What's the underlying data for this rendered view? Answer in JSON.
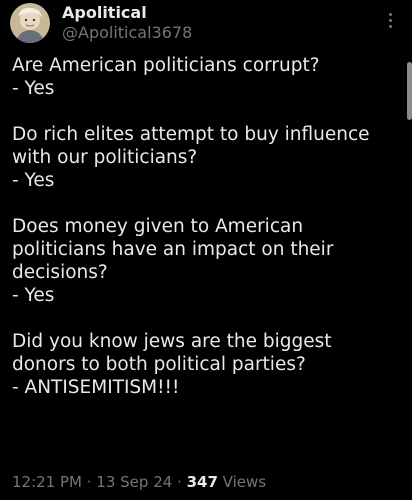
{
  "author": {
    "display_name": "Apolitical",
    "handle": "@Apolitical3678"
  },
  "tweet": {
    "paragraphs": [
      {
        "lines": [
          "Are American politicians corrupt?",
          "- Yes"
        ]
      },
      {
        "lines": [
          "Do rich elites attempt to buy influence",
          "with our politicians?",
          "- Yes"
        ]
      },
      {
        "lines": [
          "Does money given to American",
          "politicians have an impact on their",
          "decisions?",
          "- Yes"
        ]
      },
      {
        "lines": [
          "Did you know jews are the biggest",
          "donors to both political parties?",
          "- ANTISEMITISM!!!"
        ]
      }
    ]
  },
  "meta": {
    "time": "12:21 PM",
    "separator": " · ",
    "date": "13 Sep 24",
    "views_count": "347",
    "views_label": " Views"
  },
  "icons": {
    "avatar": "avatar-portrait",
    "more": "more-vertical-icon"
  },
  "colors": {
    "background": "#000000",
    "primary_text": "#e7e9ea",
    "secondary_text": "#71767b"
  }
}
